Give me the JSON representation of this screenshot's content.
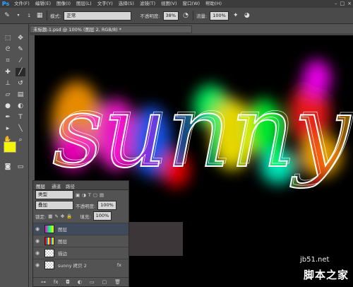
{
  "app": {
    "logo": "Ps"
  },
  "menu": [
    "文件(F)",
    "编辑(E)",
    "图像(I)",
    "图层(L)",
    "文字(Y)",
    "选择(S)",
    "滤镜(T)",
    "视图(V)",
    "窗口(W)",
    "帮助(H)"
  ],
  "window_controls": [
    "–",
    "□",
    "×"
  ],
  "options": {
    "brush_size": "1",
    "mode_label": "模式:",
    "mode_value": "正常",
    "opacity_label": "不透明度:",
    "opacity_value": "38%",
    "flow_label": "流量:",
    "flow_value": "100%"
  },
  "document": {
    "tab_title": "未标题-1.psd @ 100% (图层 2, RGB/8) *",
    "close": "×"
  },
  "canvas_art": {
    "text": "sunny"
  },
  "layers_panel": {
    "tabs": [
      "图层",
      "通道",
      "路径"
    ],
    "kind_label": "类型",
    "blend_mode": "叠加",
    "opacity_label": "不透明度:",
    "opacity_value": "100%",
    "lock_label": "锁定:",
    "fill_label": "填充:",
    "fill_value": "100%",
    "layers": [
      {
        "name": "图层",
        "thumb": "art"
      },
      {
        "name": "图层",
        "thumb": "stripes"
      },
      {
        "name": "描边",
        "thumb": "checker"
      },
      {
        "name": "sunny 拷贝 2",
        "thumb": "checker",
        "fx": "fx"
      }
    ],
    "footer_icons": [
      "link-icon",
      "fx-icon",
      "mask-icon",
      "adjustment-icon",
      "folder-icon",
      "new-layer-icon",
      "trash-icon"
    ]
  },
  "colors": {
    "foreground": "#f5f500",
    "background": "#000000",
    "accent": "#31a8ff"
  },
  "watermark": {
    "line1": "jb51.net",
    "line2": "脚本之家"
  }
}
